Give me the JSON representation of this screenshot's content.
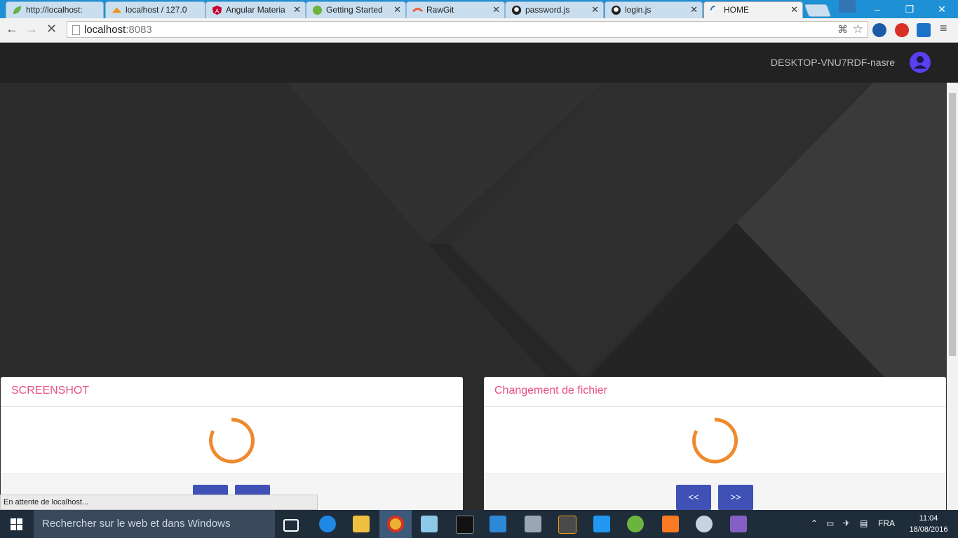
{
  "browser": {
    "tabs": [
      {
        "title": "http://localhost:",
        "icon": "leaf-icon"
      },
      {
        "title": "localhost / 127.0",
        "icon": "pma-icon"
      },
      {
        "title": "Angular Materia",
        "icon": "angular-icon"
      },
      {
        "title": "Getting Started",
        "icon": "spring-icon"
      },
      {
        "title": "RawGit",
        "icon": "rawgit-icon"
      },
      {
        "title": "password.js",
        "icon": "github-icon"
      },
      {
        "title": "login.js",
        "icon": "github-icon"
      },
      {
        "title": "HOME",
        "icon": "loading-icon"
      }
    ],
    "window_controls": {
      "minimize": "–",
      "restore": "❐",
      "close": "✕"
    },
    "url_host": "localhost",
    "url_port": ":8083",
    "status_text": "En attente de localhost..."
  },
  "app": {
    "username": "DESKTOP-VNU7RDF-nasre",
    "cards": [
      {
        "title": "SCREENSHOT",
        "buttons": [
          "",
          ""
        ]
      },
      {
        "title": "Changement de fichier",
        "buttons": [
          "<<",
          ">>"
        ]
      }
    ]
  },
  "taskbar": {
    "search_placeholder": "Rechercher sur le web et dans Windows",
    "language": "FRA",
    "time": "11:04",
    "date": "18/08/2016"
  },
  "colors": {
    "accent_pink": "#e94f85",
    "button_indigo": "#3f51b5",
    "spinner_orange": "#ef8a2c",
    "avatar_purple": "#5b3ff2"
  }
}
